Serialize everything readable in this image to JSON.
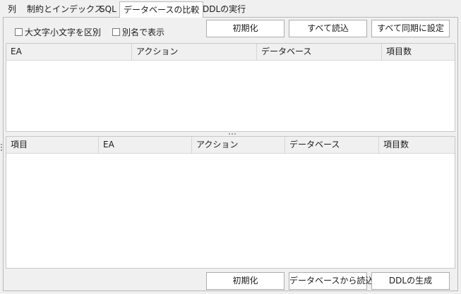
{
  "tabs": [
    {
      "label": "列",
      "active": false
    },
    {
      "label": "制約とインデックス",
      "active": false
    },
    {
      "label": "SQL",
      "active": false
    },
    {
      "label": "データベースの比較",
      "active": true
    },
    {
      "label": "DDLの実行",
      "active": false
    }
  ],
  "options": {
    "case_sensitive_label": "大文字小文字を区別",
    "case_sensitive_checked": false,
    "alias_label": "別名で表示",
    "alias_checked": false
  },
  "top_buttons": {
    "reset": "初期化",
    "load_all": "すべて読込",
    "sync_all": "すべて同期に設定"
  },
  "upper_table": {
    "columns": [
      "EA",
      "アクション",
      "データベース",
      "項目数"
    ],
    "rows": []
  },
  "lower_table": {
    "columns": [
      "項目",
      "EA",
      "アクション",
      "データベース",
      "項目数"
    ],
    "rows": []
  },
  "bottom_buttons": {
    "reset": "初期化",
    "load_from_db": "データベースから読込",
    "generate_ddl": "DDLの生成"
  }
}
